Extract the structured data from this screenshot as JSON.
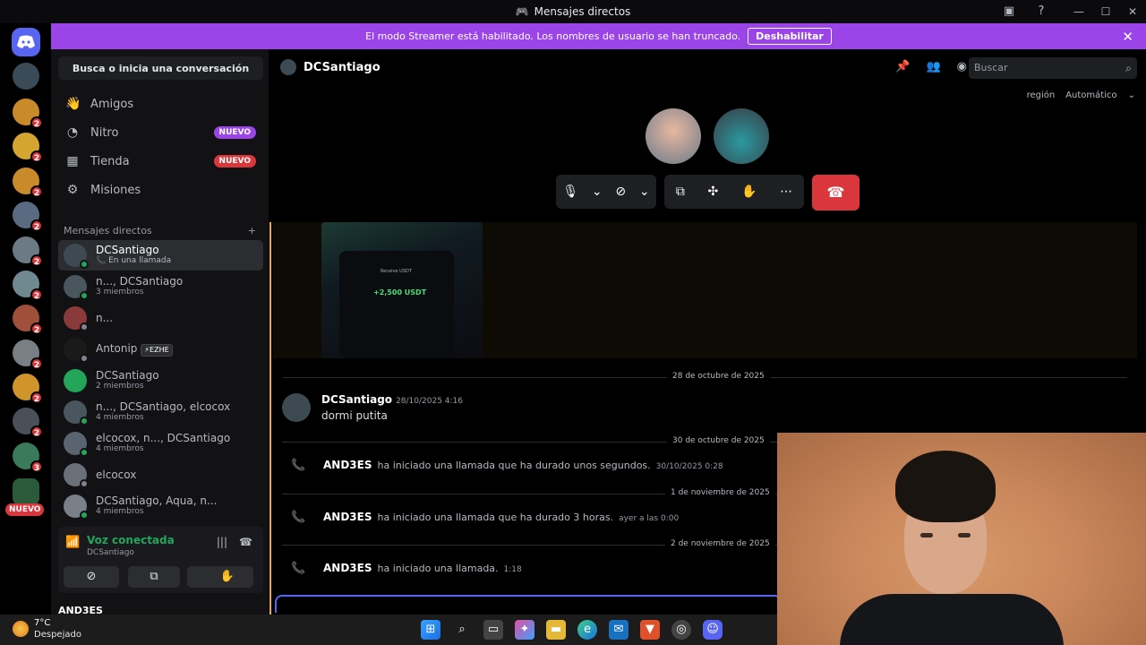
{
  "window": {
    "title": "Mensajes directos"
  },
  "banner": {
    "text": "El modo Streamer está habilitado. Los nombres de usuario se han truncado.",
    "button": "Deshabilitar"
  },
  "rail": {
    "badges": [
      "2",
      "2",
      "2",
      "2",
      "2",
      "2",
      "2",
      "2",
      "2",
      "2",
      "3"
    ],
    "nuevo": "NUEVO"
  },
  "sidebar": {
    "search": "Busca o inicia una conversación",
    "nav": [
      {
        "label": "Amigos",
        "icon": "friends-icon"
      },
      {
        "label": "Nitro",
        "icon": "nitro-icon",
        "badge": "NUEVO"
      },
      {
        "label": "Tienda",
        "icon": "shop-icon",
        "badge": "NUEVO"
      },
      {
        "label": "Misiones",
        "icon": "quests-icon"
      }
    ],
    "dm_header": "Mensajes directos",
    "dms": [
      {
        "name": "DCSantiago",
        "sub": "En una llamada"
      },
      {
        "name": "n..., DCSantiago",
        "sub": "3 miembros"
      },
      {
        "name": "n...",
        "sub": ""
      },
      {
        "name": "Antonip",
        "sub": "",
        "tag": "EZHE"
      },
      {
        "name": "DCSantiago",
        "sub": "2 miembros"
      },
      {
        "name": "n..., DCSantiago, elcocox",
        "sub": "4 miembros"
      },
      {
        "name": "elcocox, n..., DCSantiago",
        "sub": "4 miembros"
      },
      {
        "name": "elcocox",
        "sub": ""
      },
      {
        "name": "DCSantiago, Aqua, n...",
        "sub": "4 miembros"
      }
    ],
    "voice": {
      "status": "Voz conectada",
      "channel": "DCSantiago"
    },
    "user": "AND3ES"
  },
  "main": {
    "channel": "DCSantiago",
    "search_placeholder": "Buscar",
    "region_label": "región",
    "region_value": "Automático",
    "image": {
      "amount": "+2,500 USDT",
      "title": "Receive USDT"
    },
    "divider1": "28 de octubre de 2025",
    "msg1": {
      "author": "DCSantiago",
      "time": "28/10/2025 4:16",
      "text": "dormi putita"
    },
    "divider2": "30 de octubre de 2025",
    "call1": {
      "author": "AND3ES",
      "text": "ha iniciado una llamada que ha durado unos segundos.",
      "time": "30/10/2025 0:28"
    },
    "divider3": "1 de noviembre de 2025",
    "call2": {
      "author": "AND3ES",
      "text": "ha iniciado una llamada que ha durado 3 horas.",
      "time": "ayer a las 0:00"
    },
    "divider4": "2 de noviembre de 2025",
    "call3": {
      "author": "AND3ES",
      "text": "ha iniciado una llamada.",
      "time": "1:18"
    }
  },
  "taskbar": {
    "temp": "7°C",
    "weather": "Despejado"
  },
  "colors": {
    "accent": "#5865f2",
    "banner": "#9b44e8",
    "danger": "#da373c",
    "online": "#23a55a"
  }
}
